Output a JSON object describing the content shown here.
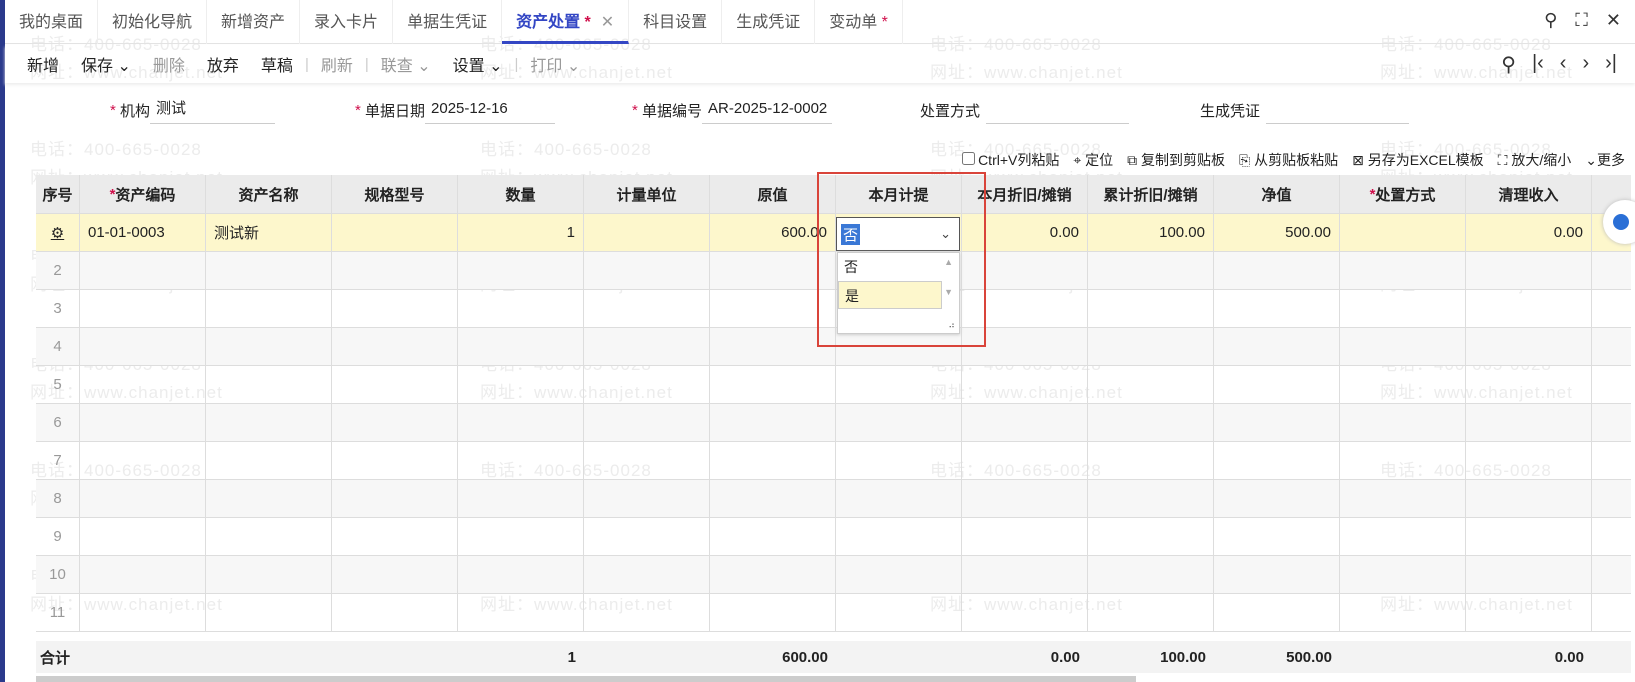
{
  "tabs": [
    {
      "label": "我的桌面"
    },
    {
      "label": "初始化导航"
    },
    {
      "label": "新增资产"
    },
    {
      "label": "录入卡片"
    },
    {
      "label": "单据生凭证"
    },
    {
      "label": "资产处置",
      "active": true,
      "modified": true,
      "closable": true
    },
    {
      "label": "科目设置"
    },
    {
      "label": "生成凭证"
    },
    {
      "label": "变动单",
      "modified": true
    }
  ],
  "window_icons": [
    "search-icon",
    "maximize-icon",
    "close-icon"
  ],
  "toolbar": {
    "new": "新增",
    "save": "保存",
    "delete": "删除",
    "discard": "放弃",
    "draft": "草稿",
    "refresh": "刷新",
    "link": "联查",
    "settings": "设置",
    "print": "打印"
  },
  "form": {
    "org_label": "机构",
    "org_value": "测试",
    "date_label": "单据日期",
    "date_value": "2025-12-16",
    "no_label": "单据编号",
    "no_value": "AR-2025-12-0002",
    "method_label": "处置方式",
    "method_value": "",
    "voucher_label": "生成凭证",
    "voucher_value": ""
  },
  "grid_tools": {
    "paste_col": "Ctrl+V列粘贴",
    "locate": "定位",
    "copy": "复制到剪贴板",
    "paste": "从剪贴板粘贴",
    "save_excel": "另存为EXCEL模板",
    "zoom": "放大/缩小",
    "more": "更多"
  },
  "columns": [
    {
      "label": "序号"
    },
    {
      "label": "资产编码",
      "required": true
    },
    {
      "label": "资产名称"
    },
    {
      "label": "规格型号"
    },
    {
      "label": "数量"
    },
    {
      "label": "计量单位"
    },
    {
      "label": "原值"
    },
    {
      "label": "本月计提"
    },
    {
      "label": "本月折旧/摊销"
    },
    {
      "label": "累计折旧/摊销"
    },
    {
      "label": "净值"
    },
    {
      "label": "处置方式",
      "required": true
    },
    {
      "label": "清理收入"
    }
  ],
  "rows": [
    [
      "",
      "01-01-0003",
      "测试新",
      "",
      "1",
      "",
      "600.00",
      "否",
      "0.00",
      "100.00",
      "500.00",
      "",
      "0.00"
    ]
  ],
  "row_numbers": [
    "2",
    "3",
    "4",
    "5",
    "6",
    "7",
    "8",
    "9",
    "10",
    "11"
  ],
  "dropdown": {
    "value": "否",
    "options": [
      "否",
      "是"
    ],
    "highlighted": "是"
  },
  "totals": {
    "label": "合计",
    "qty": "1",
    "orig": "600.00",
    "dep_month": "0.00",
    "dep_total": "100.00",
    "net": "500.00",
    "income": "0.00"
  },
  "watermark": {
    "phone": "电话：400-665-0028",
    "site": "网址：www.chanjet.net"
  },
  "colors": {
    "accent": "#3346c4",
    "required": "#d0104c",
    "selected_row": "#fdf7cc",
    "highlight_box": "#d9443a"
  }
}
